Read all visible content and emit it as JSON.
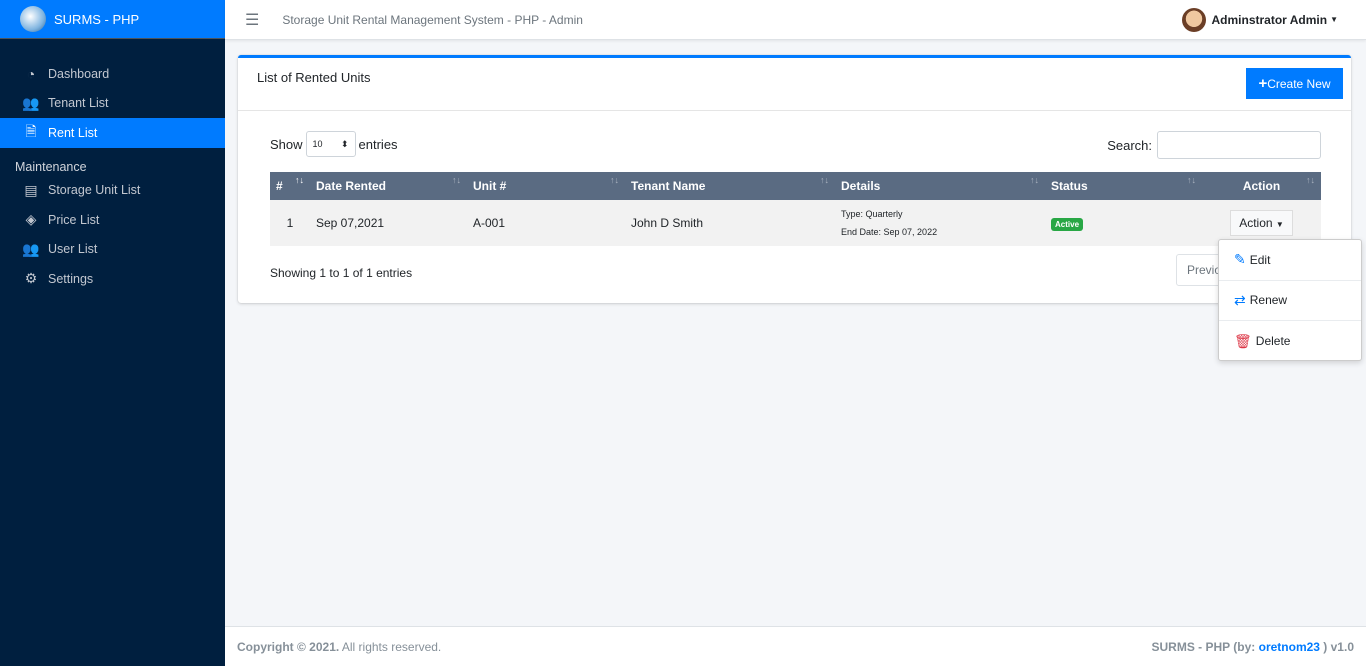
{
  "brand": {
    "name": "SURMS - PHP"
  },
  "sidebar": {
    "items": [
      {
        "label": "Dashboard",
        "icon": "tachometer-icon"
      },
      {
        "label": "Tenant List",
        "icon": "users-icon"
      },
      {
        "label": "Rent List",
        "icon": "file-contract-icon",
        "active": true
      }
    ],
    "section": "Maintenance",
    "maint": [
      {
        "label": "Storage Unit List",
        "icon": "warehouse-icon"
      },
      {
        "label": "Price List",
        "icon": "tags-icon"
      },
      {
        "label": "User List",
        "icon": "users-icon"
      },
      {
        "label": "Settings",
        "icon": "cogs-icon"
      }
    ]
  },
  "topbar": {
    "title": "Storage Unit Rental Management System - PHP - Admin",
    "user": "Adminstrator Admin"
  },
  "card": {
    "title": "List of Rented Units",
    "create_label": "Create New"
  },
  "table_controls": {
    "show": "Show",
    "entries_value": "10",
    "entries": "entries",
    "search_label": "Search:",
    "info": "Showing 1 to 1 of 1 entries",
    "previous": "Previous"
  },
  "table": {
    "headers": [
      "#",
      "Date Rented",
      "Unit #",
      "Tenant Name",
      "Details",
      "Status",
      "Action"
    ],
    "rows": [
      {
        "num": "1",
        "date": "Sep 07,2021",
        "unit": "A-001",
        "tenant": "John D Smith",
        "type": "Type: Quarterly",
        "end": "End Date: Sep 07, 2022",
        "status": "Active",
        "action": "Action"
      }
    ]
  },
  "menu": {
    "items": [
      "Edit",
      "Renew",
      "Delete"
    ]
  },
  "footer": {
    "copyright": "Copyright © 2021.",
    "rights": " All rights reserved.",
    "right_prefix": "SURMS - PHP (by: ",
    "author": "oretnom23",
    "right_suffix": " ) v1.0"
  },
  "colors": {
    "sidebar": "#001f3f",
    "primary": "#007bff",
    "success": "#28a745",
    "danger": "#dc3545",
    "table_header": "#5a6b82"
  }
}
